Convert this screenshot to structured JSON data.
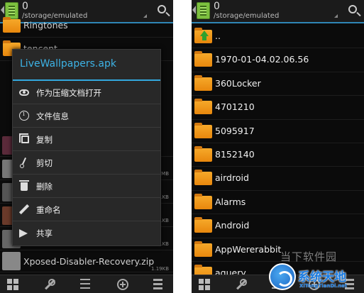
{
  "left_screen": {
    "header": {
      "title": "0",
      "path": "/storage/emulated"
    },
    "bg_items": [
      {
        "label": "Ringtones",
        "size": ""
      },
      {
        "label": "tencent",
        "size": ""
      },
      {
        "label": "",
        "size": ""
      },
      {
        "label": "",
        "size": ""
      },
      {
        "label": "",
        "size": ""
      },
      {
        "label": "",
        "size": "1MB"
      },
      {
        "label": "",
        "size": "1KB"
      },
      {
        "label": "",
        "size": "1KB"
      },
      {
        "label": "",
        "size": "1KB"
      },
      {
        "label": "",
        "size": "0KB"
      },
      {
        "label": "Xposed-Disabler-Recovery.zip",
        "size": "1.19KB"
      }
    ],
    "context_menu": {
      "title": "LiveWallpapers.apk",
      "items": [
        {
          "label": "作为压缩文档打开",
          "icon": "eye-icon"
        },
        {
          "label": "文件信息",
          "icon": "info-icon"
        },
        {
          "label": "复制",
          "icon": "copy-icon"
        },
        {
          "label": "剪切",
          "icon": "scissors-icon"
        },
        {
          "label": "删除",
          "icon": "trash-icon"
        },
        {
          "label": "重命名",
          "icon": "pencil-icon"
        },
        {
          "label": "共享",
          "icon": "share-icon"
        }
      ]
    }
  },
  "right_screen": {
    "header": {
      "title": "0",
      "path": "/storage/emulated"
    },
    "items": [
      {
        "label": "..",
        "icon": "parent-folder-icon"
      },
      {
        "label": "1970-01-04.02.06.56",
        "icon": "folder-icon"
      },
      {
        "label": "360Locker",
        "icon": "folder-icon"
      },
      {
        "label": "4701210",
        "icon": "folder-icon"
      },
      {
        "label": "5095917",
        "icon": "folder-icon"
      },
      {
        "label": "8152140",
        "icon": "folder-icon"
      },
      {
        "label": "airdroid",
        "icon": "folder-icon"
      },
      {
        "label": "Alarms",
        "icon": "folder-icon"
      },
      {
        "label": "Android",
        "icon": "folder-icon"
      },
      {
        "label": "AppWererabbit",
        "icon": "folder-icon"
      },
      {
        "label": "aquery",
        "icon": "folder-icon"
      }
    ]
  },
  "bottom_bar": [
    "grid-icon",
    "wrench-icon",
    "sort-icon",
    "plus-icon",
    "menu-icon"
  ],
  "watermark": {
    "text": "当下软件园",
    "brand": "系统天地",
    "url": "XiTongTianDi.net"
  },
  "colors": {
    "accent": "#33a8de",
    "folder": "#f0a020",
    "background": "#0b0b0b"
  }
}
